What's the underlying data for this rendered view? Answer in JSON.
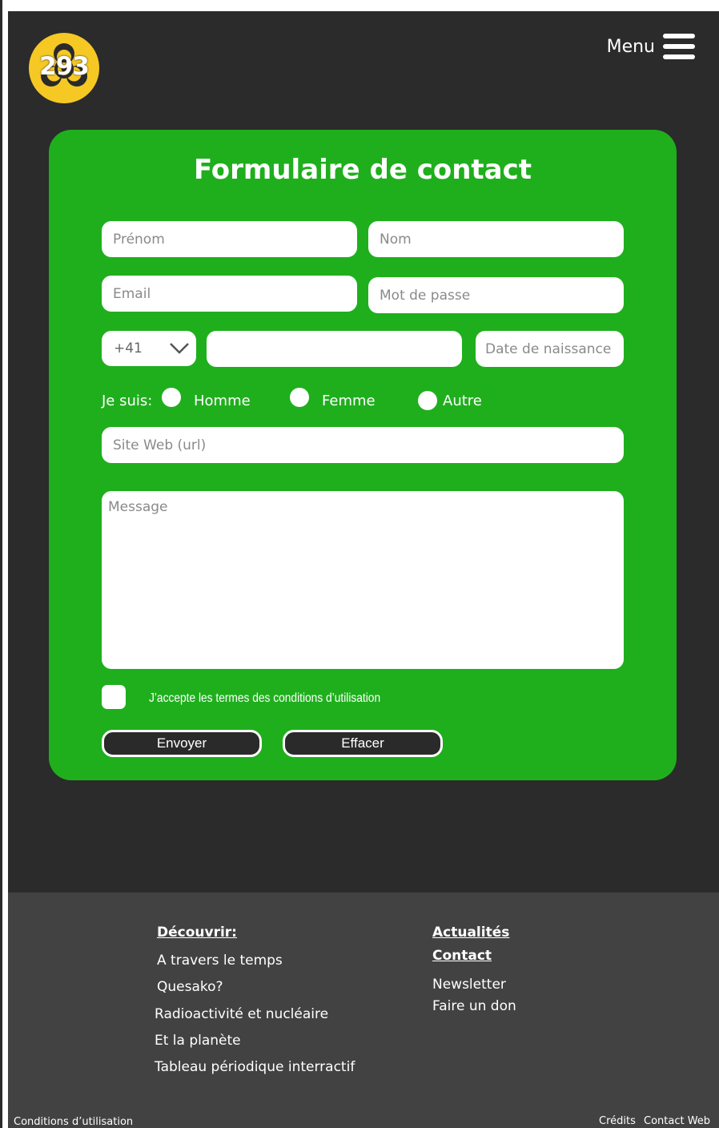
{
  "header": {
    "logo_text": "293",
    "menu_label": "Menu"
  },
  "form": {
    "title": "Formulaire de contact",
    "firstname_placeholder": "Prénom",
    "lastname_placeholder": "Nom",
    "email_placeholder": "Email",
    "password_placeholder": "Mot de passe",
    "phone_prefix": "+41",
    "phone_value": "",
    "birthdate_placeholder": "Date de naissance",
    "gender_label": "Je suis:",
    "gender_options": [
      "Homme",
      "Femme",
      "Autre"
    ],
    "website_placeholder": "Site Web (url)",
    "message_placeholder": "Message",
    "terms_label": "J’accepte les termes des conditions d’utilisation",
    "submit_label": "Envoyer",
    "reset_label": "Effacer"
  },
  "footer": {
    "discover_heading": "Découvrir:",
    "discover_links": [
      "A travers le temps",
      "Quesako?",
      "Radioactivité et nucléaire",
      "Et la planète",
      "Tableau périodique interractif"
    ],
    "news_heading": "Actualités",
    "contact_heading": "Contact",
    "contact_links": [
      "Newsletter",
      "Faire un don"
    ],
    "terms_link": "Conditions d’utilisation",
    "credits_link": "Crédits",
    "contact_web_link": "Contact Web"
  },
  "colors": {
    "background": "#2b2b2b",
    "card": "#1faf1d",
    "footer": "#424242",
    "logo": "#f5c824"
  },
  "icons": [
    "biohazard-logo-icon",
    "hamburger-menu-icon",
    "chevron-down-icon"
  ]
}
